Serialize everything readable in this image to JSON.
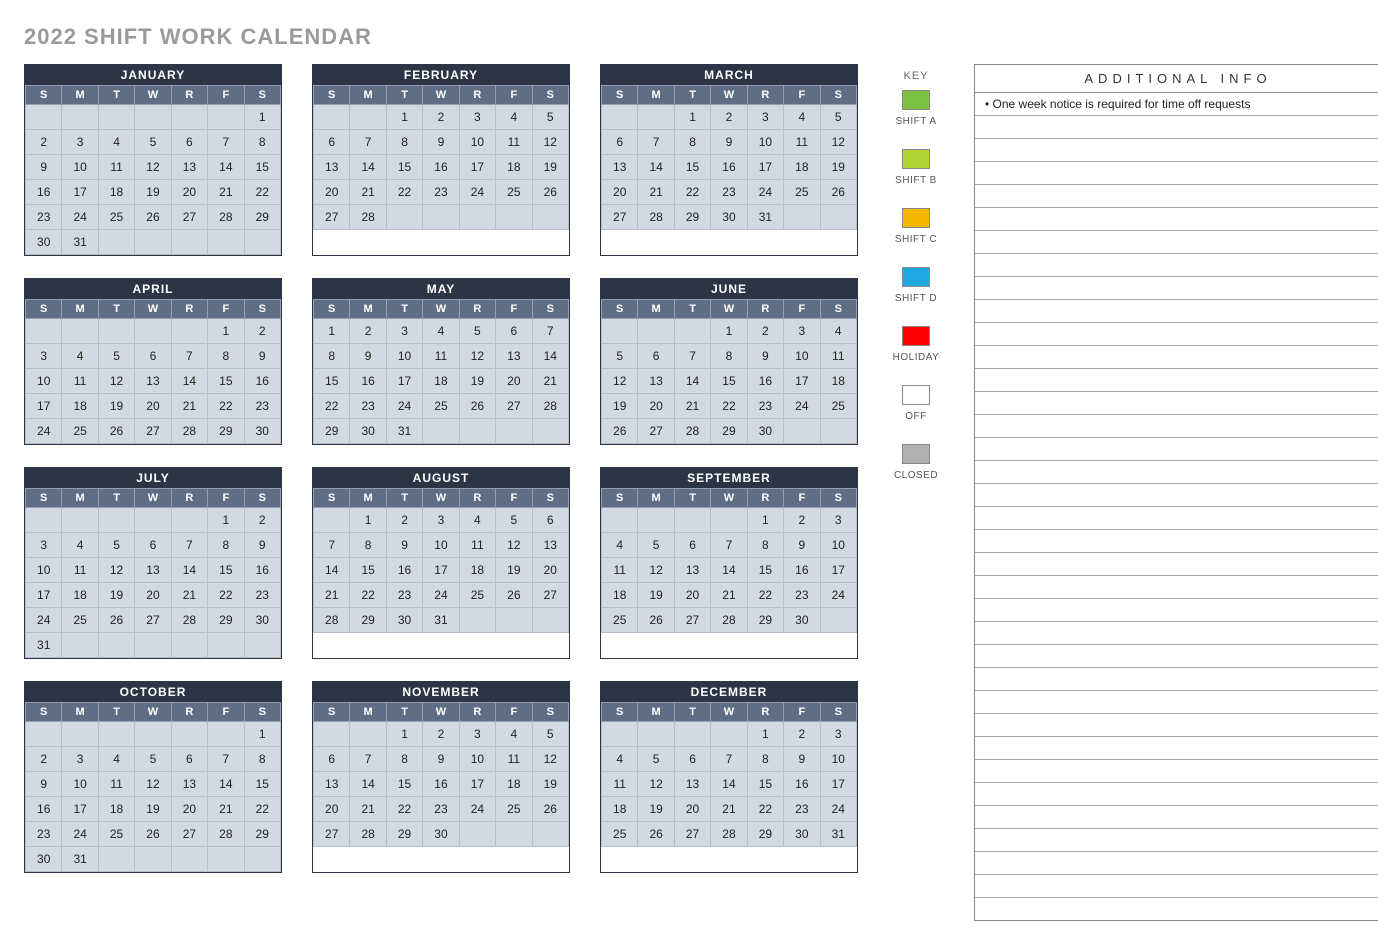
{
  "title": "2022 SHIFT WORK CALENDAR",
  "day_headers": [
    "S",
    "M",
    "T",
    "W",
    "R",
    "F",
    "S"
  ],
  "months": [
    {
      "name": "JANUARY",
      "start": 6,
      "days": 31
    },
    {
      "name": "FEBRUARY",
      "start": 2,
      "days": 28
    },
    {
      "name": "MARCH",
      "start": 2,
      "days": 31
    },
    {
      "name": "APRIL",
      "start": 5,
      "days": 30
    },
    {
      "name": "MAY",
      "start": 0,
      "days": 31
    },
    {
      "name": "JUNE",
      "start": 3,
      "days": 30
    },
    {
      "name": "JULY",
      "start": 5,
      "days": 31
    },
    {
      "name": "AUGUST",
      "start": 1,
      "days": 31
    },
    {
      "name": "SEPTEMBER",
      "start": 4,
      "days": 30
    },
    {
      "name": "OCTOBER",
      "start": 6,
      "days": 31
    },
    {
      "name": "NOVEMBER",
      "start": 2,
      "days": 30
    },
    {
      "name": "DECEMBER",
      "start": 4,
      "days": 31
    }
  ],
  "key": {
    "title": "KEY",
    "items": [
      {
        "label": "SHIFT A",
        "color": "#7cc242"
      },
      {
        "label": "SHIFT B",
        "color": "#b3d335"
      },
      {
        "label": "SHIFT C",
        "color": "#f5b800"
      },
      {
        "label": "SHIFT D",
        "color": "#1fa8e0"
      },
      {
        "label": "HOLIDAY",
        "color": "#ff0000"
      },
      {
        "label": "OFF",
        "color": "#ffffff"
      },
      {
        "label": "CLOSED",
        "color": "#b0b0b0"
      }
    ]
  },
  "info": {
    "title": "ADDITIONAL INFO",
    "rows": [
      "• One week notice is required for time off requests",
      "",
      "",
      "",
      "",
      "",
      "",
      "",
      "",
      "",
      "",
      "",
      "",
      "",
      "",
      "",
      "",
      "",
      "",
      "",
      "",
      "",
      "",
      "",
      "",
      "",
      "",
      "",
      "",
      "",
      "",
      "",
      "",
      "",
      "",
      ""
    ]
  }
}
